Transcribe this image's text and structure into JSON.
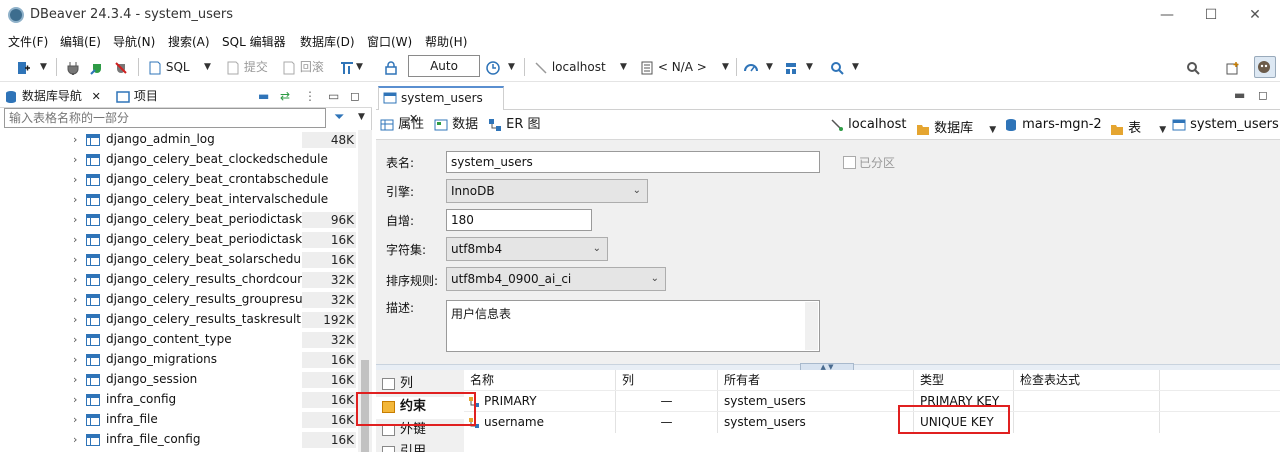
{
  "window": {
    "title": "DBeaver 24.3.4 - system_users"
  },
  "menu": [
    "文件(F)",
    "编辑(E)",
    "导航(N)",
    "搜索(A)",
    "SQL 编辑器",
    "数据库(D)",
    "窗口(W)",
    "帮助(H)"
  ],
  "toolbar": {
    "sql_label": "SQL",
    "commit_label": "提交",
    "rollback_label": "回滚",
    "transaction_mode": "Auto",
    "connection": "localhost",
    "schema": "< N/A >"
  },
  "left_panel": {
    "tab_navigator": "数据库导航",
    "tab_projects": "项目",
    "filter_placeholder": "输入表格名称的一部分",
    "tables": [
      {
        "name": "django_admin_log",
        "size": "48K"
      },
      {
        "name": "django_celery_beat_clockedschedule",
        "size": ""
      },
      {
        "name": "django_celery_beat_crontabschedule",
        "size": ""
      },
      {
        "name": "django_celery_beat_intervalschedule",
        "size": ""
      },
      {
        "name": "django_celery_beat_periodictask",
        "size": "96K"
      },
      {
        "name": "django_celery_beat_periodictasks",
        "size": "16K"
      },
      {
        "name": "django_celery_beat_solarschedule",
        "size": "16K"
      },
      {
        "name": "django_celery_results_chordcounter",
        "size": "32K"
      },
      {
        "name": "django_celery_results_groupresult",
        "size": "32K"
      },
      {
        "name": "django_celery_results_taskresult",
        "size": "192K"
      },
      {
        "name": "django_content_type",
        "size": "32K"
      },
      {
        "name": "django_migrations",
        "size": "16K"
      },
      {
        "name": "django_session",
        "size": "16K"
      },
      {
        "name": "infra_config",
        "size": "16K"
      },
      {
        "name": "infra_file",
        "size": "16K"
      },
      {
        "name": "infra_file_config",
        "size": "16K"
      }
    ]
  },
  "editor": {
    "tab_title": "system_users",
    "subtabs": {
      "properties": "属性",
      "data": "数据",
      "er": "ER 图"
    },
    "breadcrumb": {
      "connection": "localhost",
      "database_label": "数据库",
      "database": "mars-mgn-2",
      "table_label": "表",
      "table": "system_users"
    },
    "form": {
      "table_name_label": "表名:",
      "table_name": "system_users",
      "partitioned_label": "已分区",
      "engine_label": "引擎:",
      "engine": "InnoDB",
      "auto_increment_label": "自增:",
      "auto_increment": "180",
      "charset_label": "字符集:",
      "charset": "utf8mb4",
      "collation_label": "排序规则:",
      "collation": "utf8mb4_0900_ai_ci",
      "description_label": "描述:",
      "description": "用户信息表"
    },
    "nav": {
      "columns": "列",
      "constraints": "约束",
      "foreign_keys": "外键",
      "references": "引用"
    },
    "constraints": {
      "headers": {
        "name": "名称",
        "column": "列",
        "owner": "所有者",
        "type": "类型",
        "check": "检查表达式"
      },
      "rows": [
        {
          "name": "PRIMARY",
          "column": "—",
          "owner": "system_users",
          "type": "PRIMARY KEY",
          "check": ""
        },
        {
          "name": "username",
          "column": "—",
          "owner": "system_users",
          "type": "UNIQUE KEY",
          "check": ""
        }
      ]
    }
  }
}
